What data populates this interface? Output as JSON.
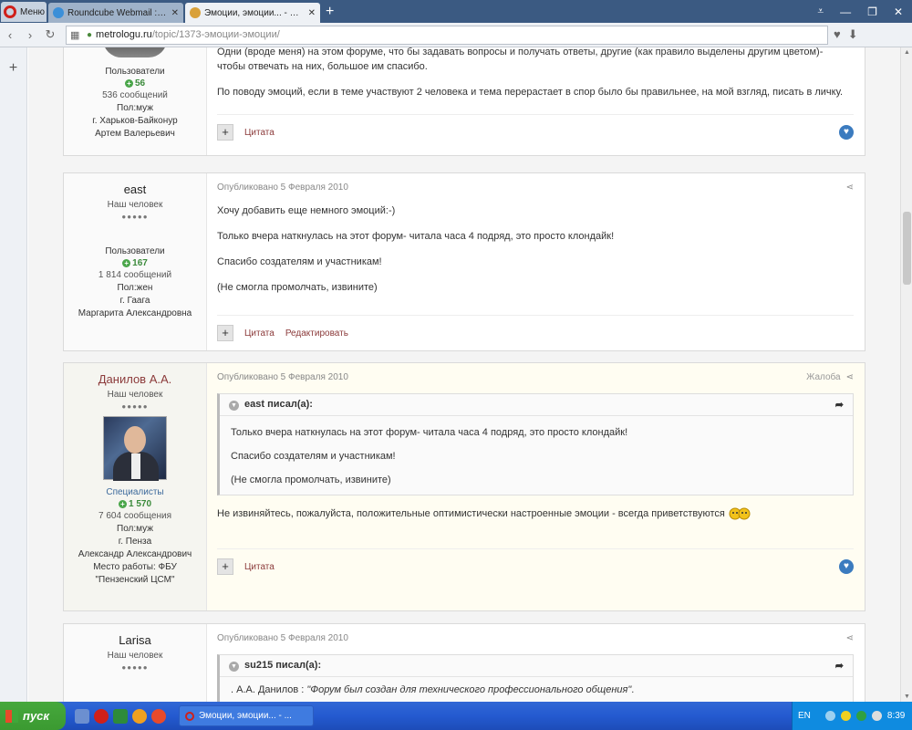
{
  "browser": {
    "menu_label": "Меню",
    "tabs": [
      {
        "title": "Roundcube Webmail :: Входящие",
        "active": false
      },
      {
        "title": "Эмоции, эмоции... - Вопросы",
        "active": true
      }
    ],
    "new_tab": "+",
    "url_host": "metrologu.ru",
    "url_path": "/topic/1373-эмоции-эмоции/"
  },
  "sidebar": {
    "plus": "+"
  },
  "posts": [
    {
      "author": {
        "group": "Пользователи",
        "reputation": "56",
        "posts_count": "536 сообщений",
        "gender": "Пол:муж",
        "city": "г. Харьков-Байконур",
        "full_name": "Артем Валерьевич"
      },
      "paragraphs": [
        "Одни (вроде меня) на этом форуме, что бы задавать вопросы и получать ответы, другие (как правило выделены другим цветом)- чтобы отвечать на них, большое им спасибо.",
        "По поводу эмоций, если в теме участвуют 2 человека и тема перерастает в спор было бы правильнее, на мой взгляд, писать в личку."
      ],
      "actions": {
        "quote": "Цитата"
      }
    },
    {
      "author": {
        "name": "east",
        "rank": "Наш человек",
        "group": "Пользователи",
        "reputation": "167",
        "posts_count": "1 814 сообщений",
        "gender": "Пол:жен",
        "city": "г. Гаага",
        "full_name": "Маргарита Александровна"
      },
      "published": "Опубликовано 5 Февраля 2010",
      "paragraphs": [
        "Хочу добавить еще немного эмоций:-)",
        "Только вчера наткнулась на этот форум- читала часа 4 подряд, это просто клондайк!",
        "Спасибо создателям и участникам!",
        "(Не смогла промолчать, извините)"
      ],
      "actions": {
        "quote": "Цитата",
        "edit": "Редактировать"
      }
    },
    {
      "author": {
        "name": "Данилов А.А.",
        "rank": "Наш человек",
        "group": "Специалисты",
        "reputation": "1 570",
        "posts_count": "7 604 сообщения",
        "gender": "Пол:муж",
        "city": "г. Пенза",
        "full_name": "Александр Александрович",
        "work_1": "Место работы: ФБУ",
        "work_2": "\"Пензенский ЦСМ\""
      },
      "published": "Опубликовано 5 Февраля 2010",
      "complaint": "Жалоба",
      "quote": {
        "header": "east писал(а):",
        "paragraphs": [
          "Только вчера наткнулась на этот форум- читала часа 4 подряд, это просто клондайк!",
          "Спасибо создателям и участникам!",
          "(Не смогла промолчать, извините)"
        ]
      },
      "reply": "Не извиняйтесь, пожалуйста, положительные оптимистически настроенные эмоции - всегда приветствуются",
      "actions": {
        "quote": "Цитата"
      }
    },
    {
      "author": {
        "name": "Larisa",
        "rank": "Наш человек"
      },
      "published": "Опубликовано 5 Февраля 2010",
      "quote": {
        "header": "su215 писал(а):",
        "text_prefix": ". А.А. Данилов : ",
        "text_quote": "\"Форум был создан для технического профессионального общения\"",
        "text_suffix": "."
      }
    }
  ],
  "taskbar": {
    "start_label": "пуск",
    "task_title": "Эмоции, эмоции... - ...",
    "lang": "EN",
    "clock": "8:39"
  }
}
